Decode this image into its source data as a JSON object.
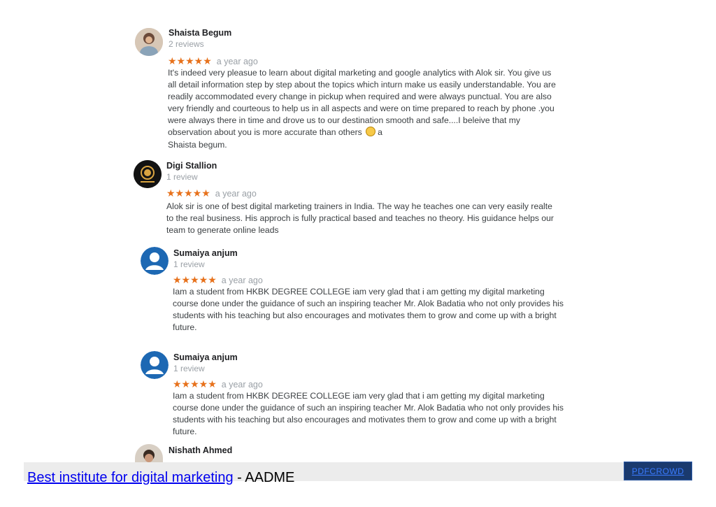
{
  "reviews": [
    {
      "name": "Shaista Begum",
      "count": "2 reviews",
      "stars": "★★★★★",
      "time": "a year ago",
      "lines": [
        "It's indeed very pleasue to learn about digital marketing  and google analytics  with Alok sir. You give us",
        "all detail information step  by step about the topics which inturn make us easily understandable. You are",
        "readily accommodated every change in pickup when required and were always punctual. You are also",
        "very friendly and courteous to help us in all aspects and were on time prepared to reach by phone .you",
        "were always there in time and drove us to our destination smooth and safe....I beleive that my",
        "observation about you is more  accurate  than others",
        "Shaista begum."
      ],
      "line6_suffix": "a"
    },
    {
      "name": "Digi Stallion",
      "count": "1 review",
      "stars": "★★★★★",
      "time": "a year ago",
      "lines": [
        "Alok sir is one of best digital marketing trainers in India. The way he teaches one can very easily realte",
        "to the real business. His approch is fully practical based and teaches no theory. His guidance helps our",
        "team to generate online leads"
      ]
    },
    {
      "name": "Sumaiya anjum",
      "count": "1 review",
      "stars": "★★★★★",
      "time": "a year ago",
      "lines": [
        "Iam a student from HKBK DEGREE COLLEGE iam very glad that i am getting my digital marketing",
        "course done under the guidance of such an inspiring teacher Mr. Alok Badatia who not only provides his",
        "students with his teaching but also encourages and motivates them to grow and  come up with a bright",
        "future."
      ]
    },
    {
      "name": "Sumaiya anjum",
      "count": "1 review",
      "stars": "★★★★★",
      "time": "a year ago",
      "lines": [
        "Iam a student from HKBK DEGREE COLLEGE iam very glad that i am getting my digital marketing",
        "course done under the guidance of such an inspiring teacher Mr. Alok Badatia who not only provides his",
        "students with his teaching but also encourages and motivates them to grow and  come up with a bright",
        "future."
      ]
    },
    {
      "name": "Nishath Ahmed"
    }
  ],
  "footer": {
    "link_text": "Best institute for digital marketing",
    "suffix": " - AADME",
    "badge": "PDFCROWD"
  },
  "colors": {
    "star": "#e7711b",
    "link": "#0000ee",
    "badge_bg": "#1a3a6e"
  },
  "icons": {
    "avatar_default": "person-silhouette",
    "emoji": "smiling-face"
  }
}
